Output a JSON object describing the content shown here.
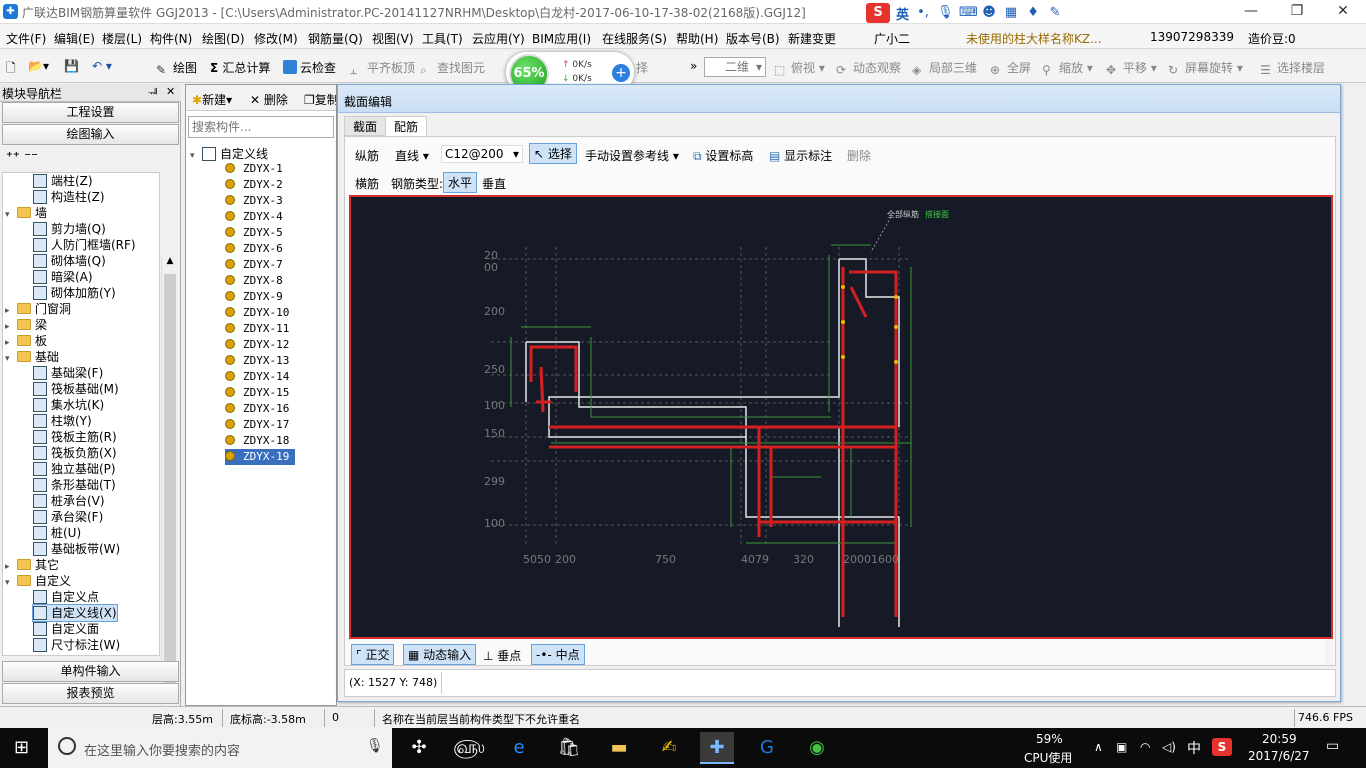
{
  "title": {
    "app": "广联达BIM钢筋算量软件 GGJ2013 - [C:\\Users\\Administrator.PC-20141127NRHM\\Desktop\\白龙村-2017-06-10-17-38-02(2168版).GGJ12]",
    "ime_label": "英",
    "minimize": "—",
    "restore": "❐",
    "close": "✕"
  },
  "menu": {
    "items": [
      "文件(F)",
      "编辑(E)",
      "楼层(L)",
      "构件(N)",
      "绘图(D)",
      "修改(M)",
      "钢筋量(Q)",
      "视图(V)",
      "工具(T)",
      "云应用(Y)",
      "BIM应用(I)",
      "在线服务(S)",
      "帮助(H)",
      "版本号(B)",
      "新建变更",
      "广小二"
    ],
    "notice": "未使用的柱大样名称KZ...",
    "phone": "13907298339",
    "price": "造价豆:0"
  },
  "toolbar": {
    "draw": "绘图",
    "sum": "汇总计算",
    "cloud_check": "云检查",
    "align_top": "平齐板顶",
    "find": "查找图元",
    "select_partial": "择",
    "view_mode": "二维",
    "top_view": "俯视",
    "dynamic": "动态观察",
    "local3d": "局部三维",
    "fullscreen": "全屏",
    "zoom": "缩放",
    "pan": "平移",
    "rotate": "屏幕旋转",
    "select_floor": "选择楼层"
  },
  "network": {
    "percent": "65%",
    "up": "0K/s",
    "down": "0K/s"
  },
  "left_panel": {
    "header": "模块导航栏",
    "pin": "ᅰ",
    "close": "✕",
    "project_settings": "工程设置",
    "draw_input": "绘图输入",
    "single_input": "单构件输入",
    "report": "报表预览",
    "tree": [
      {
        "label": "端柱(Z)",
        "indent": 2,
        "type": "item"
      },
      {
        "label": "构造柱(Z)",
        "indent": 2,
        "type": "item"
      },
      {
        "label": "墙",
        "indent": 1,
        "type": "folder",
        "exp": "▾"
      },
      {
        "label": "剪力墙(Q)",
        "indent": 2,
        "type": "item"
      },
      {
        "label": "人防门框墙(RF)",
        "indent": 2,
        "type": "item"
      },
      {
        "label": "砌体墙(Q)",
        "indent": 2,
        "type": "item"
      },
      {
        "label": "暗梁(A)",
        "indent": 2,
        "type": "item"
      },
      {
        "label": "砌体加筋(Y)",
        "indent": 2,
        "type": "item"
      },
      {
        "label": "门窗洞",
        "indent": 1,
        "type": "folder",
        "exp": "▸"
      },
      {
        "label": "梁",
        "indent": 1,
        "type": "folder",
        "exp": "▸"
      },
      {
        "label": "板",
        "indent": 1,
        "type": "folder",
        "exp": "▸"
      },
      {
        "label": "基础",
        "indent": 1,
        "type": "folder",
        "exp": "▾"
      },
      {
        "label": "基础梁(F)",
        "indent": 2,
        "type": "item"
      },
      {
        "label": "筏板基础(M)",
        "indent": 2,
        "type": "item"
      },
      {
        "label": "集水坑(K)",
        "indent": 2,
        "type": "item"
      },
      {
        "label": "柱墩(Y)",
        "indent": 2,
        "type": "item"
      },
      {
        "label": "筏板主筋(R)",
        "indent": 2,
        "type": "item"
      },
      {
        "label": "筏板负筋(X)",
        "indent": 2,
        "type": "item"
      },
      {
        "label": "独立基础(P)",
        "indent": 2,
        "type": "item"
      },
      {
        "label": "条形基础(T)",
        "indent": 2,
        "type": "item"
      },
      {
        "label": "桩承台(V)",
        "indent": 2,
        "type": "item"
      },
      {
        "label": "承台梁(F)",
        "indent": 2,
        "type": "item"
      },
      {
        "label": "桩(U)",
        "indent": 2,
        "type": "item"
      },
      {
        "label": "基础板带(W)",
        "indent": 2,
        "type": "item"
      },
      {
        "label": "其它",
        "indent": 1,
        "type": "folder",
        "exp": "▸"
      },
      {
        "label": "自定义",
        "indent": 1,
        "type": "folder",
        "exp": "▾"
      },
      {
        "label": "自定义点",
        "indent": 2,
        "type": "item"
      },
      {
        "label": "自定义线(X)",
        "indent": 2,
        "type": "item",
        "selected": true
      },
      {
        "label": "自定义面",
        "indent": 2,
        "type": "item"
      },
      {
        "label": "尺寸标注(W)",
        "indent": 2,
        "type": "item"
      }
    ]
  },
  "mid_panel": {
    "new": "新建",
    "delete": "删除",
    "copy": "复制",
    "search_placeholder": "搜索构件...",
    "root": "自定义线",
    "items": [
      "ZDYX-1",
      "ZDYX-2",
      "ZDYX-3",
      "ZDYX-4",
      "ZDYX-5",
      "ZDYX-6",
      "ZDYX-7",
      "ZDYX-8",
      "ZDYX-9",
      "ZDYX-10",
      "ZDYX-11",
      "ZDYX-12",
      "ZDYX-13",
      "ZDYX-14",
      "ZDYX-15",
      "ZDYX-16",
      "ZDYX-17",
      "ZDYX-18",
      "ZDYX-19"
    ],
    "selected_index": 18
  },
  "dialog": {
    "title": "截面编辑",
    "tabs": [
      "截面",
      "配筋"
    ],
    "active_tab": 1,
    "row1": {
      "long_bar": "纵筋",
      "line_type": "直线",
      "spec": "C12@200",
      "select": "选择",
      "manual_ref": "手动设置参考线",
      "set_elev": "设置标高",
      "show_dim": "显示标注",
      "delete": "删除"
    },
    "row2": {
      "cross_bar": "横筋",
      "bar_type": "钢筋类型:",
      "horizontal": "水平",
      "vertical": "垂直"
    },
    "bottom": {
      "ortho": "正交",
      "dyn_input": "动态输入",
      "perpendicular": "垂点",
      "midpoint": "中点"
    },
    "coords": "(X: 1527 Y: 748)"
  },
  "canvas": {
    "label_all": "全部纵筋",
    "label_green": "搭接面",
    "left_dims": [
      "20",
      "00",
      "200",
      "250",
      "100",
      "150",
      "299",
      "100"
    ],
    "bottom_dims": [
      "5050",
      "200",
      "750",
      "4079",
      "320",
      "20001600"
    ]
  },
  "status": {
    "floor_height": "层高:3.55m",
    "bottom_elev": "底标高:-3.58m",
    "zero": "0",
    "message": "名称在当前层当前构件类型下不允许重名",
    "fps": "746.6 FPS"
  },
  "taskbar": {
    "search_placeholder": "在这里输入你要搜索的内容",
    "cpu_pct": "59%",
    "cpu_label": "CPU使用",
    "lang": "中",
    "time": "20:59",
    "date": "2017/6/27"
  }
}
